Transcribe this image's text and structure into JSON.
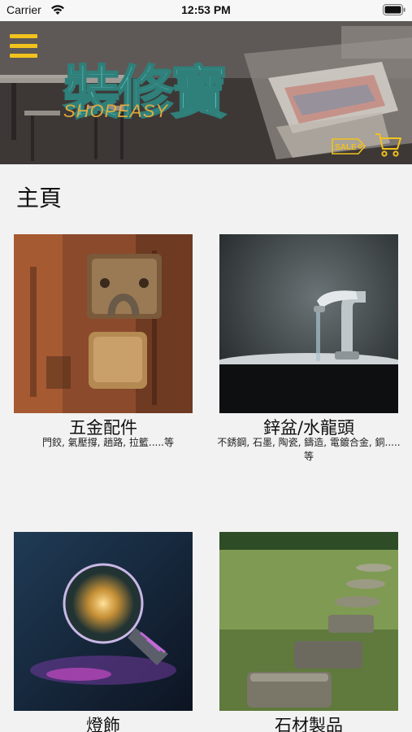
{
  "status_bar": {
    "carrier": "Carrier",
    "time": "12:53 PM"
  },
  "header": {
    "logo_text": "裝修寶",
    "logo_subtext": "SHOPEASY",
    "sale_badge": "SALE",
    "menu_icon": "hamburger-menu-icon",
    "cart_icon": "shopping-cart-icon",
    "accent_color": "#f2c21d",
    "logo_color": "#57b9b3"
  },
  "page": {
    "title": "主頁"
  },
  "categories": [
    {
      "title": "五金配件",
      "desc": "門鉸, 氣壓撐, 趟路, 拉籃.....等"
    },
    {
      "title": "鋅盆/水龍頭",
      "desc": "不銹鋼, 石墨, 陶瓷, 鑄造, 電鍍合金, 銅.....等"
    },
    {
      "title": "燈飾",
      "desc": ""
    },
    {
      "title": "石材製品",
      "desc": ""
    }
  ]
}
